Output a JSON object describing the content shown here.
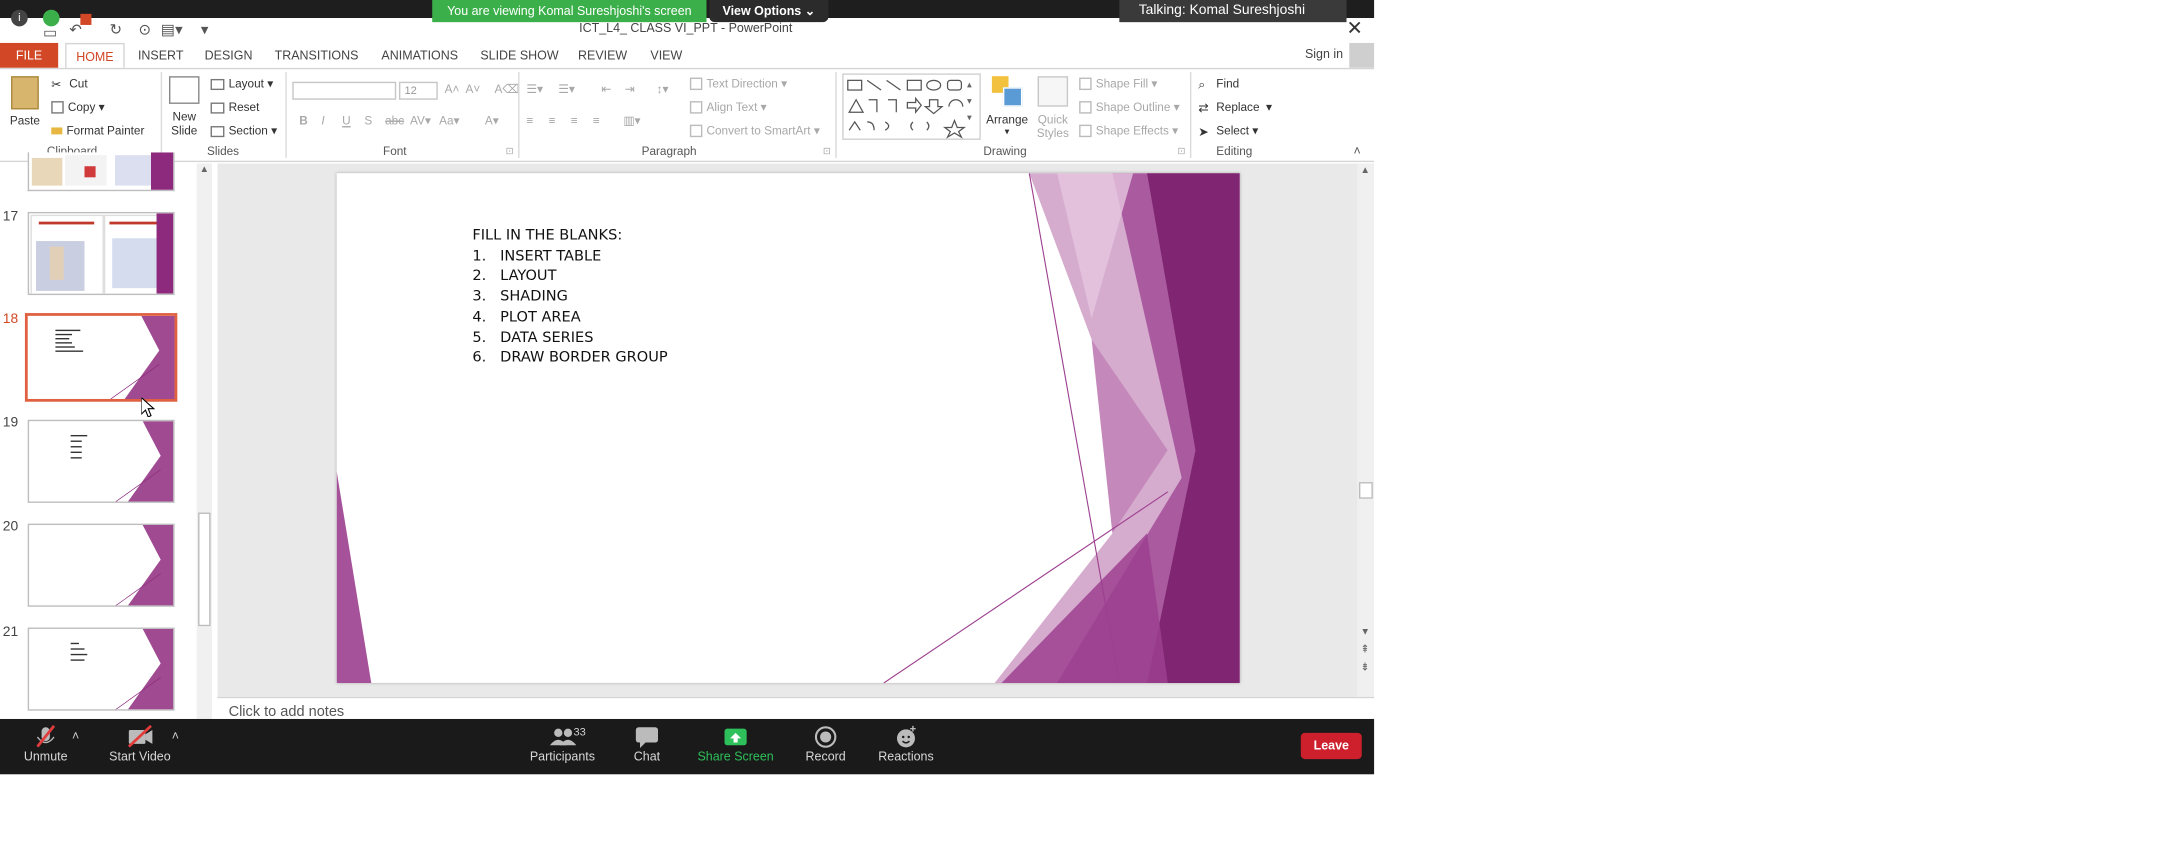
{
  "zoom": {
    "viewing_banner": "You are viewing Komal Sureshjoshi's screen",
    "view_options": "View Options",
    "talking": "Talking: Komal Sureshjoshi",
    "toolbar": {
      "unmute": "Unmute",
      "start_video": "Start Video",
      "participants": "Participants",
      "participants_count": "33",
      "chat": "Chat",
      "share_screen": "Share Screen",
      "record": "Record",
      "reactions": "Reactions",
      "leave": "Leave"
    }
  },
  "window": {
    "title": "ICT_L4_ CLASS VI_PPT - PowerPoint",
    "sign_in": "Sign in"
  },
  "ribbon": {
    "tabs": [
      "FILE",
      "HOME",
      "INSERT",
      "DESIGN",
      "TRANSITIONS",
      "ANIMATIONS",
      "SLIDE SHOW",
      "REVIEW",
      "VIEW"
    ],
    "active_tab": "HOME",
    "clipboard": {
      "paste": "Paste",
      "cut": "Cut",
      "copy": "Copy",
      "format_painter": "Format Painter",
      "label": "Clipboard"
    },
    "slides": {
      "new_slide_1": "New",
      "new_slide_2": "Slide",
      "layout": "Layout",
      "reset": "Reset",
      "section": "Section",
      "label": "Slides"
    },
    "font": {
      "size": "12",
      "label": "Font"
    },
    "paragraph": {
      "text_direction": "Text Direction",
      "align_text": "Align Text",
      "convert_smartart": "Convert to SmartArt",
      "label": "Paragraph"
    },
    "drawing": {
      "arrange": "Arrange",
      "quick_styles_1": "Quick",
      "quick_styles_2": "Styles",
      "shape_fill": "Shape Fill",
      "shape_outline": "Shape Outline",
      "shape_effects": "Shape Effects",
      "label": "Drawing"
    },
    "editing": {
      "find": "Find",
      "replace": "Replace",
      "select": "Select",
      "label": "Editing"
    }
  },
  "thumbnails": [
    {
      "number": "17",
      "selected": false
    },
    {
      "number": "18",
      "selected": true
    },
    {
      "number": "19",
      "selected": false
    },
    {
      "number": "20",
      "selected": false
    },
    {
      "number": "21",
      "selected": false
    }
  ],
  "slide": {
    "heading": "FILL IN THE BLANKS:",
    "items": [
      "1.   INSERT TABLE",
      "2.   LAYOUT",
      "3.   SHADING",
      "4.   PLOT AREA",
      "5.   DATA SERIES",
      "6.   DRAW BORDER GROUP"
    ]
  },
  "notes_placeholder": "Click to add notes",
  "colors": {
    "file_tab": "#d24726",
    "accent_purple": "#8e2a7e",
    "zoom_green": "#3bb04a",
    "leave_red": "#cd1f2c"
  }
}
